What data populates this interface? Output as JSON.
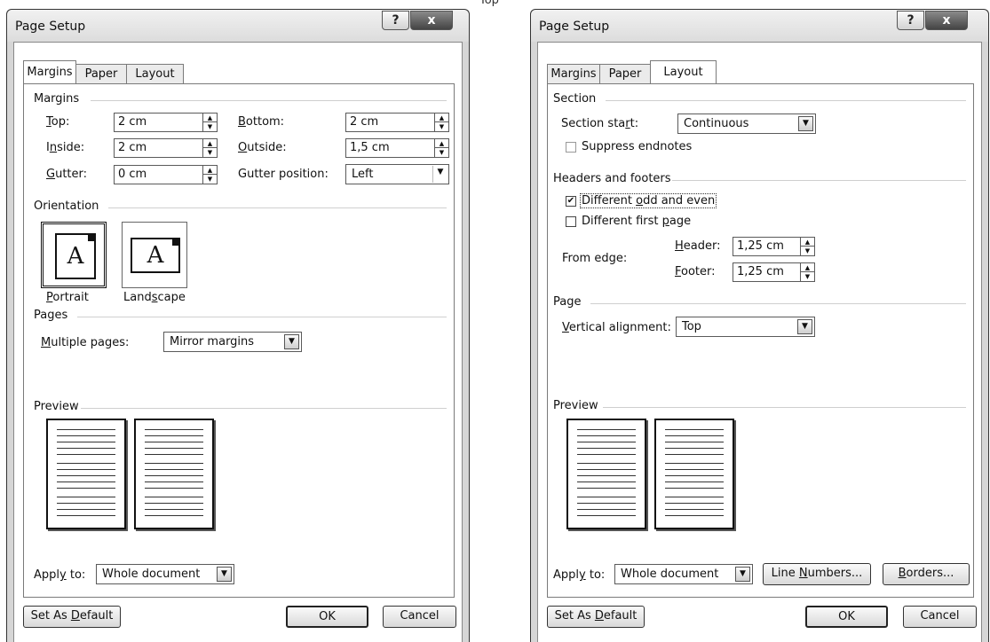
{
  "top_fragment": "Top",
  "left_dialog": {
    "title": "Page Setup",
    "help": "?",
    "close": "x",
    "tabs": [
      "Margins",
      "Paper",
      "Layout"
    ],
    "margins_section": "Margins",
    "top_label_u": "T",
    "top_label_rest": "op:",
    "top_value": "2 cm",
    "inside_label_a": "I",
    "inside_label_u": "n",
    "inside_label_rest": "side:",
    "inside_value": "2 cm",
    "gutter_label_u": "G",
    "gutter_label_rest": "utter:",
    "gutter_value": "0 cm",
    "bottom_label_u": "B",
    "bottom_label_rest": "ottom:",
    "bottom_value": "2 cm",
    "outside_label_u": "O",
    "outside_label_rest": "utside:",
    "outside_value": "1,5 cm",
    "gutter_position_label": "Gutter position:",
    "gutter_position_value": "Left",
    "orientation_section": "Orientation",
    "portrait_label_u": "P",
    "portrait_label_rest": "ortrait",
    "landscape_label_a": "Land",
    "landscape_label_u": "s",
    "landscape_label_rest": "cape",
    "orientation_glyph": "A",
    "pages_section": "Pages",
    "multiple_label_u": "M",
    "multiple_label_rest": "ultiple pages:",
    "multiple_value": "Mirror margins",
    "preview_section": "Preview",
    "apply_label_a": "Appl",
    "apply_label_u": "y",
    "apply_label_rest": " to:",
    "apply_value": "Whole document",
    "set_default_a": "Set As ",
    "set_default_u": "D",
    "set_default_rest": "efault",
    "ok": "OK",
    "cancel": "Cancel"
  },
  "right_dialog": {
    "title": "Page Setup",
    "help": "?",
    "close": "x",
    "tabs": [
      "Margins",
      "Paper",
      "Layout"
    ],
    "section_section": "Section",
    "section_start_a": "Section sta",
    "section_start_u": "r",
    "section_start_rest": "t:",
    "section_start_value": "Continuous",
    "suppress_label": "Suppress endnotes",
    "headers_section": "Headers and footers",
    "diff_odd_a": "Different ",
    "diff_odd_u": "o",
    "diff_odd_rest": "dd and even",
    "diff_first_a": "Different first ",
    "diff_first_u": "p",
    "diff_first_rest": "age",
    "from_edge_label": "From edge:",
    "header_label_u": "H",
    "header_label_rest": "eader:",
    "header_value": "1,25 cm",
    "footer_label_u": "F",
    "footer_label_rest": "ooter:",
    "footer_value": "1,25 cm",
    "page_section": "Page",
    "valign_label_u": "V",
    "valign_label_rest": "ertical alignment:",
    "valign_value": "Top",
    "preview_section": "Preview",
    "apply_label_a": "Appl",
    "apply_label_u": "y",
    "apply_label_rest": " to:",
    "apply_value": "Whole document",
    "line_numbers_a": "Line ",
    "line_numbers_u": "N",
    "line_numbers_rest": "umbers...",
    "borders_u": "B",
    "borders_rest": "orders...",
    "set_default_a": "Set As ",
    "set_default_u": "D",
    "set_default_rest": "efault",
    "ok": "OK",
    "cancel": "Cancel"
  },
  "checkbox_checked_glyph": "✔",
  "arrow_up": "▲",
  "arrow_down": "▼"
}
